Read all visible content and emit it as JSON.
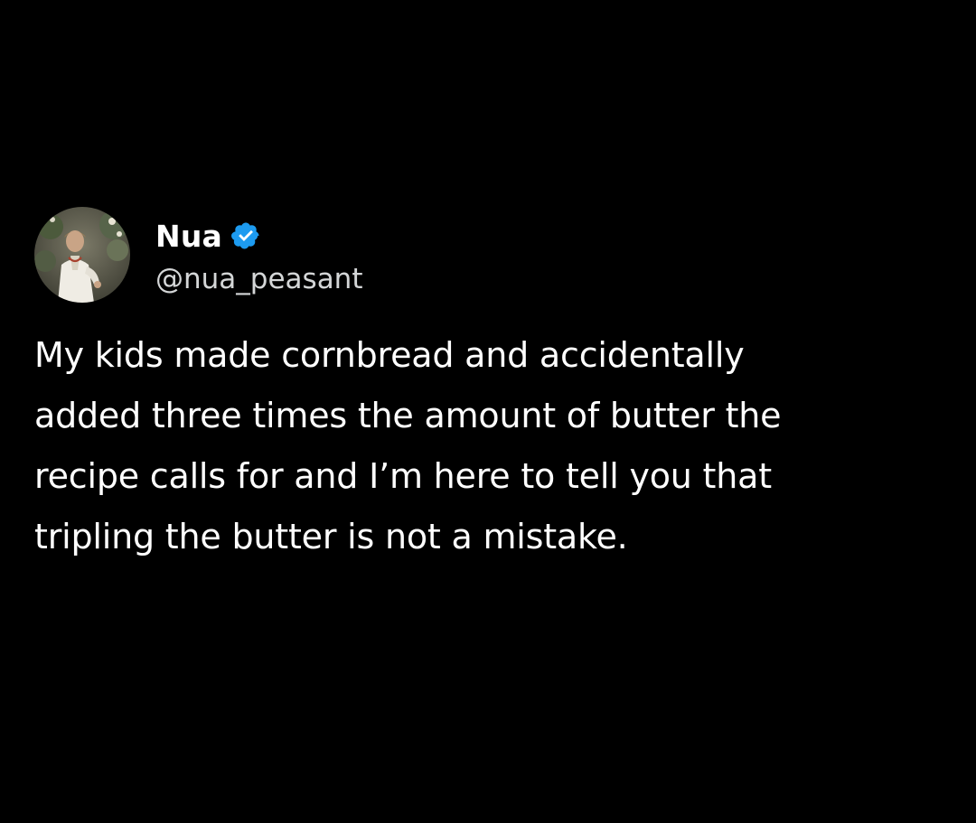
{
  "tweet": {
    "author": {
      "display_name": "Nua",
      "handle": "@nua_peasant",
      "verified": true,
      "verified_color": "#1d9bf0",
      "avatar_icon": "avatar-portrait"
    },
    "text": "My kids made cornbread and accidentally\nadded three times the amount of butter the\nrecipe calls for and I’m here to tell you that\ntripling the butter is not a mistake."
  },
  "colors": {
    "background": "#000000",
    "text": "#ffffff"
  }
}
